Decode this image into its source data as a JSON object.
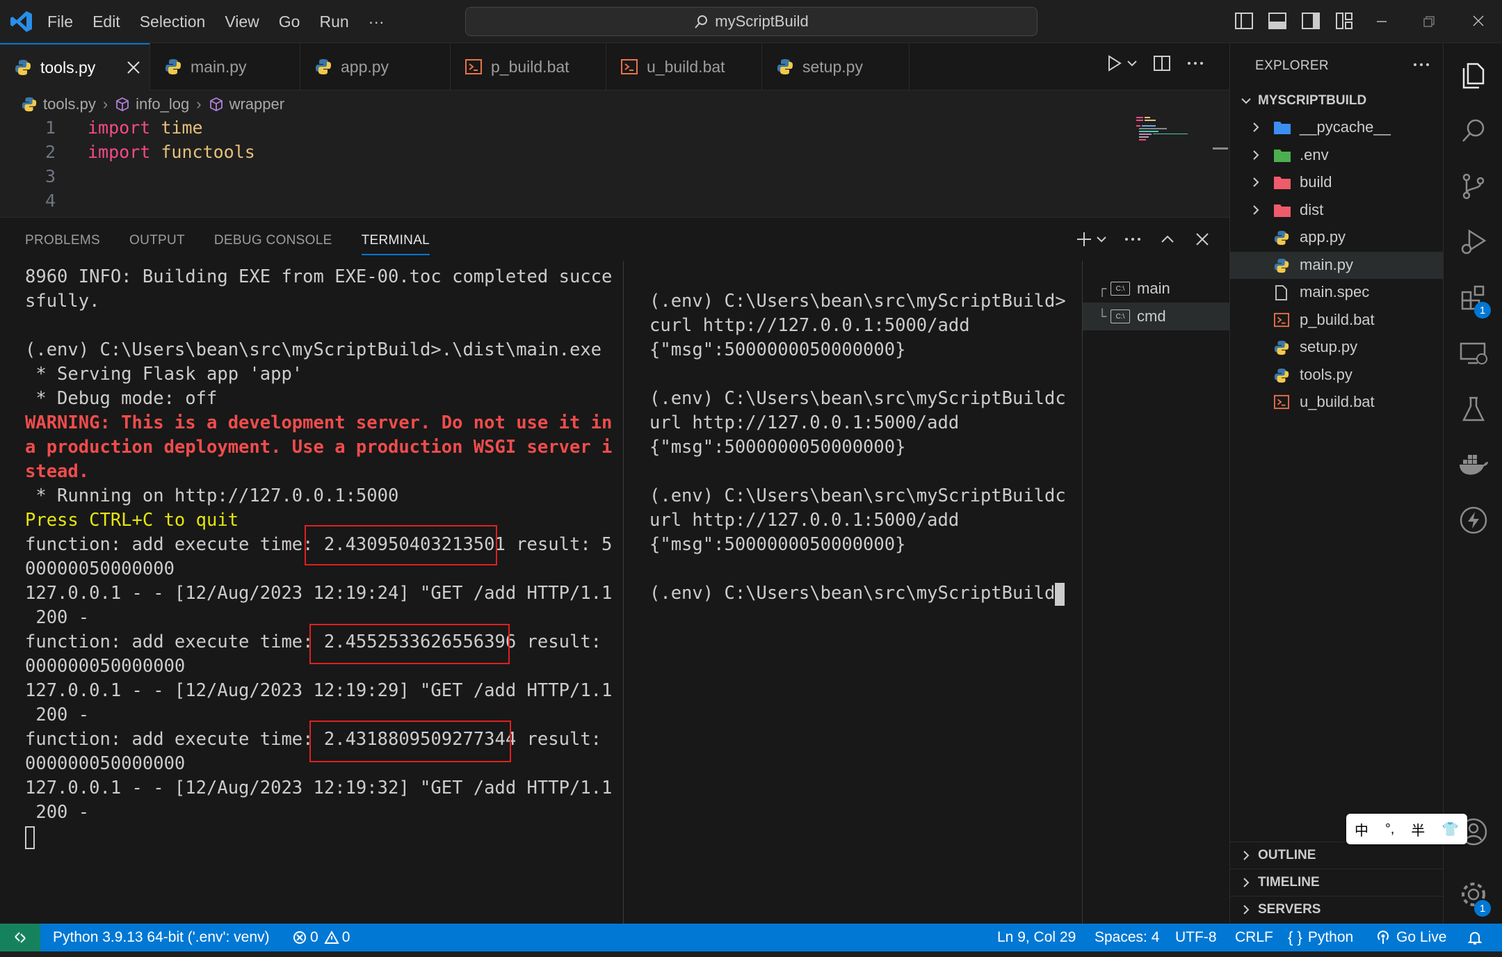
{
  "titlebar": {
    "menu": [
      "File",
      "Edit",
      "Selection",
      "View",
      "Go",
      "Run",
      "···"
    ],
    "search_label": "myScriptBuild"
  },
  "tabs": [
    {
      "label": "tools.py",
      "type": "python",
      "active": true
    },
    {
      "label": "main.py",
      "type": "python"
    },
    {
      "label": "app.py",
      "type": "python"
    },
    {
      "label": "p_build.bat",
      "type": "bat"
    },
    {
      "label": "u_build.bat",
      "type": "bat"
    },
    {
      "label": "setup.py",
      "type": "python"
    }
  ],
  "breadcrumb": [
    "tools.py",
    "info_log",
    "wrapper"
  ],
  "code": {
    "lines": [
      {
        "n": "1",
        "kw": "import",
        "id": "time"
      },
      {
        "n": "2",
        "kw": "import",
        "id": "functools"
      },
      {
        "n": "3",
        "kw": "",
        "id": ""
      },
      {
        "n": "4",
        "kw": "",
        "id": ""
      }
    ]
  },
  "panel": {
    "tabs": [
      "PROBLEMS",
      "OUTPUT",
      "DEBUG CONSOLE",
      "TERMINAL"
    ],
    "active_tab": "TERMINAL"
  },
  "terminal_left": [
    {
      "text": "8960 INFO: Building EXE from EXE-00.toc completed succes",
      "style": ""
    },
    {
      "text": "sfully.",
      "style": ""
    },
    {
      "text": "",
      "style": ""
    },
    {
      "text": "(.env) C:\\Users\\bean\\src\\myScriptBuild>.\\dist\\main.exe",
      "style": ""
    },
    {
      "text": " * Serving Flask app 'app'",
      "style": ""
    },
    {
      "text": " * Debug mode: off",
      "style": ""
    },
    {
      "text": "WARNING: This is a development server. Do not use it in",
      "style": "warn"
    },
    {
      "text": "a production deployment. Use a production WSGI server in",
      "style": "warn"
    },
    {
      "text": "stead.",
      "style": "warn"
    },
    {
      "text": " * Running on http://127.0.0.1:5000",
      "style": ""
    },
    {
      "text": "Press CTRL+C to quit",
      "style": "yellow"
    },
    {
      "text": "function: add execute time: 2.430950403213501 result: 50",
      "style": ""
    },
    {
      "text": "00000050000000",
      "style": ""
    },
    {
      "text": "127.0.0.1 - - [12/Aug/2023 12:19:24] \"GET /add HTTP/1.1\"",
      "style": ""
    },
    {
      "text": " 200 -",
      "style": ""
    },
    {
      "text": "function: add execute time: 2.4552533626556396 result: 5",
      "style": ""
    },
    {
      "text": "000000050000000",
      "style": ""
    },
    {
      "text": "127.0.0.1 - - [12/Aug/2023 12:19:29] \"GET /add HTTP/1.1\"",
      "style": ""
    },
    {
      "text": " 200 -",
      "style": ""
    },
    {
      "text": "function: add execute time: 2.4318809509277344 result: 5",
      "style": ""
    },
    {
      "text": "000000050000000",
      "style": ""
    },
    {
      "text": "127.0.0.1 - - [12/Aug/2023 12:19:32] \"GET /add HTTP/1.1\"",
      "style": ""
    },
    {
      "text": " 200 -",
      "style": ""
    }
  ],
  "terminal_right": [
    "",
    "(.env) C:\\Users\\bean\\src\\myScriptBuild>",
    "curl http://127.0.0.1:5000/add",
    "{\"msg\":5000000050000000}",
    "",
    "(.env) C:\\Users\\bean\\src\\myScriptBuildc",
    "url http://127.0.0.1:5000/add",
    "{\"msg\":5000000050000000}",
    "",
    "(.env) C:\\Users\\bean\\src\\myScriptBuildc",
    "url http://127.0.0.1:5000/add",
    "{\"msg\":5000000050000000}",
    "",
    "(.env) C:\\Users\\bean\\src\\myScriptBuild"
  ],
  "terminal_list": [
    {
      "tree": "┌",
      "label": "main"
    },
    {
      "tree": "└",
      "label": "cmd",
      "selected": true
    }
  ],
  "explorer": {
    "title": "EXPLORER",
    "root": "MYSCRIPTBUILD",
    "items": [
      {
        "name": "__pycache__",
        "kind": "folder",
        "color": "#3c8ef3"
      },
      {
        "name": ".env",
        "kind": "folder",
        "color": "#4caf50"
      },
      {
        "name": "build",
        "kind": "folder",
        "color": "#ef5b6b"
      },
      {
        "name": "dist",
        "kind": "folder",
        "color": "#ef5b6b"
      },
      {
        "name": "app.py",
        "kind": "python"
      },
      {
        "name": "main.py",
        "kind": "python",
        "selected": true
      },
      {
        "name": "main.spec",
        "kind": "file"
      },
      {
        "name": "p_build.bat",
        "kind": "bat"
      },
      {
        "name": "setup.py",
        "kind": "python"
      },
      {
        "name": "tools.py",
        "kind": "python"
      },
      {
        "name": "u_build.bat",
        "kind": "bat"
      }
    ],
    "bottom_sections": [
      "OUTLINE",
      "TIMELINE",
      "SERVERS"
    ]
  },
  "ime": {
    "items": [
      "中",
      "°,",
      "半",
      "👕"
    ]
  },
  "activity_badges": {
    "extensions": "1",
    "settings": "1"
  },
  "statusbar": {
    "interpreter": "Python 3.9.13 64-bit ('.env': venv)",
    "errors": "0",
    "warnings": "0",
    "position": "Ln 9, Col 29",
    "spaces": "Spaces: 4",
    "encoding": "UTF-8",
    "eol": "CRLF",
    "language": "Python",
    "golive": "Go Live"
  },
  "colors": {
    "accent": "#0078d4",
    "remote": "#16825d",
    "warning_text": "#f14c4c",
    "highlight_box": "#e02020"
  }
}
